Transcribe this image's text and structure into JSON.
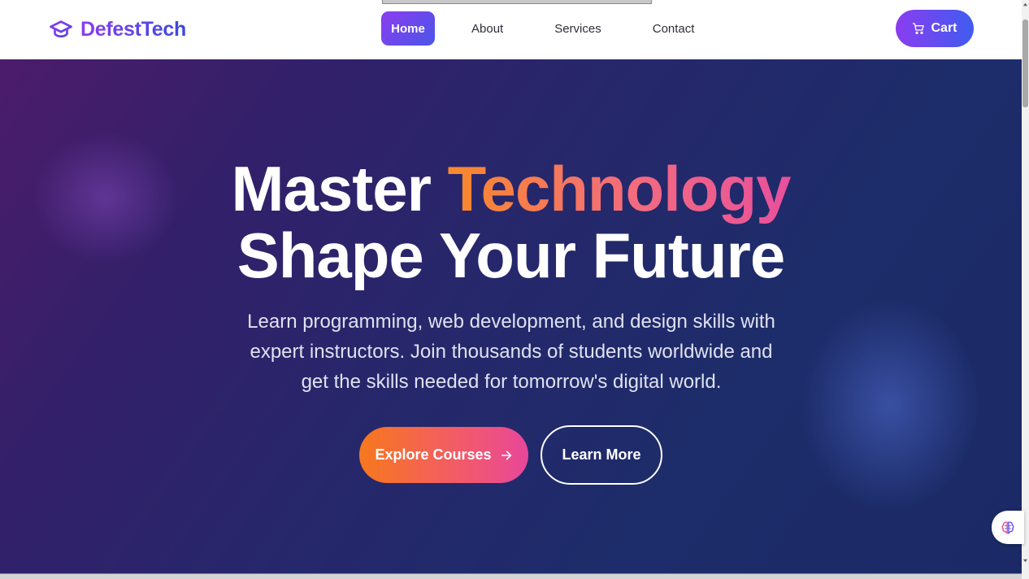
{
  "brand": {
    "name": "DefestTech",
    "icon": "graduation-cap-icon"
  },
  "nav": {
    "items": [
      {
        "label": "Home",
        "active": true
      },
      {
        "label": "About",
        "active": false
      },
      {
        "label": "Services",
        "active": false
      },
      {
        "label": "Contact",
        "active": false
      }
    ]
  },
  "cart": {
    "label": "Cart",
    "icon": "shopping-cart-icon"
  },
  "hero": {
    "title_line1_prefix": "Master",
    "title_line1_accent": "Technology",
    "title_line2": "Shape Your Future",
    "subtitle": "Learn programming, web development, and design skills with expert instructors. Join thousands of students worldwide and get the skills needed for tomorrow's digital world.",
    "primary_button": "Explore Courses",
    "primary_button_icon": "arrow-right-icon",
    "secondary_button": "Learn More"
  },
  "widget": {
    "icon": "brain-icon"
  },
  "colors": {
    "brand_purple": "#8b3df0",
    "brand_blue": "#3a49e0",
    "accent_orange": "#f7781d",
    "accent_pink": "#e8479a",
    "hero_bg": "#25286b"
  }
}
